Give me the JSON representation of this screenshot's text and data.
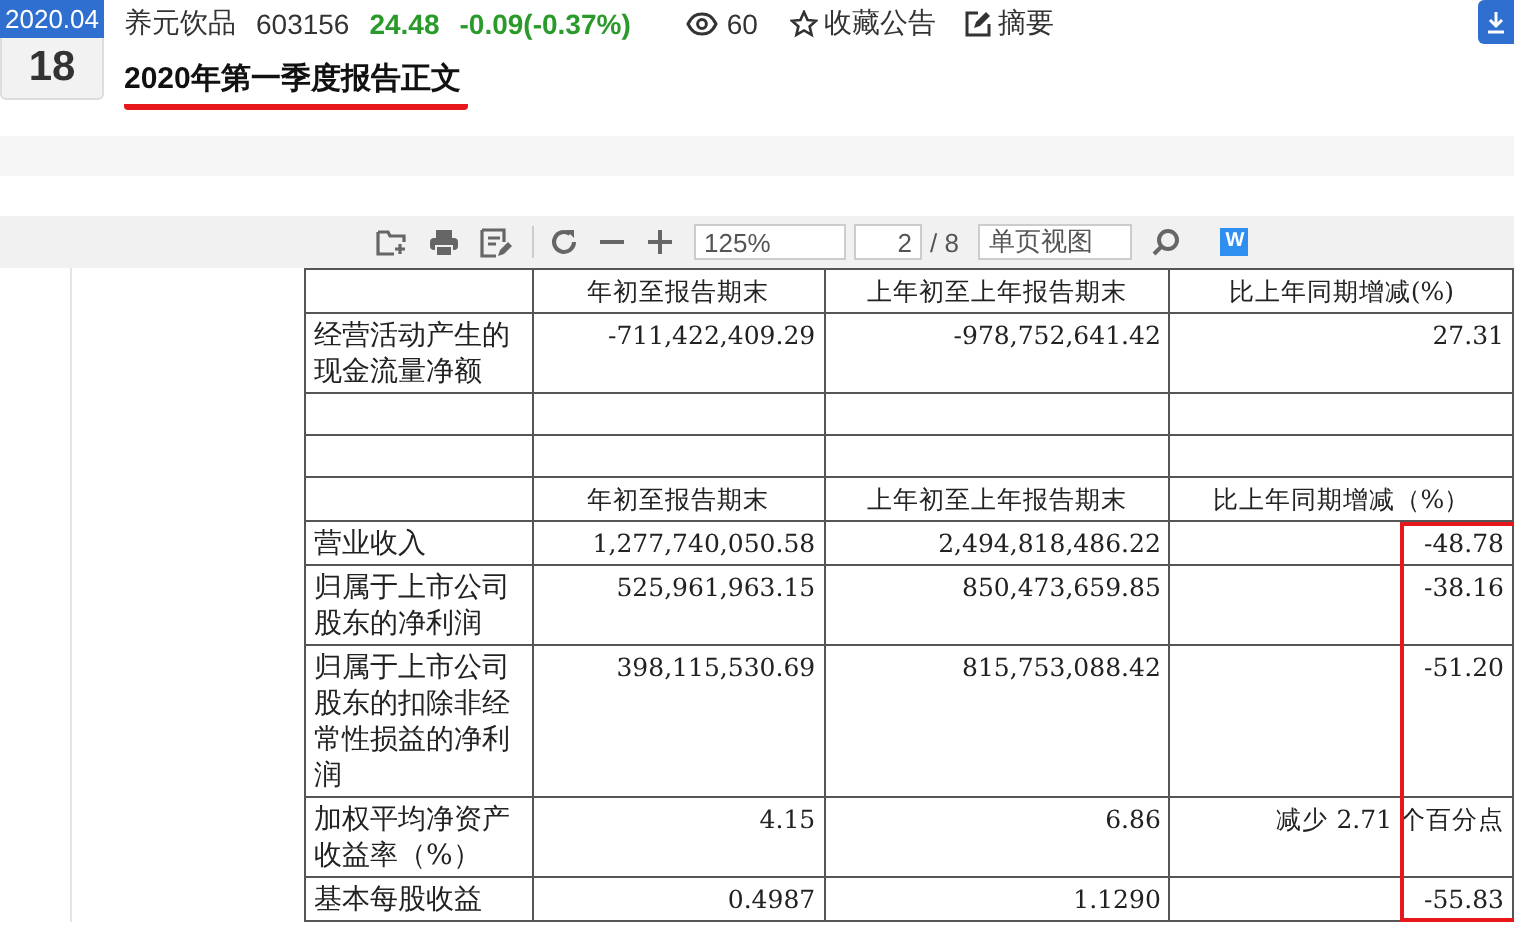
{
  "date_badge": {
    "month": "2020.04",
    "day": "18"
  },
  "stock": {
    "name": "养元饮品",
    "code": "603156",
    "price": "24.48",
    "change": "-0.09(-0.37%)"
  },
  "views": "60",
  "actions": [
    {
      "kind": "favorite",
      "label": "收藏公告"
    },
    {
      "kind": "summary",
      "label": "摘要"
    }
  ],
  "title": "2020年第一季度报告正文",
  "toolbar": {
    "zoom": "125%",
    "page": "2",
    "page_total": "/ 8",
    "view_mode": "单页视图",
    "word_label": "W"
  },
  "table": {
    "rows": [
      {
        "kind": "header",
        "cells": [
          "",
          "年初至报告期末",
          "上年初至上年报告期末",
          "比上年同期增减(%)"
        ]
      },
      {
        "kind": "data",
        "cells": [
          "经营活动产生的现金流量净额",
          "-711,422,409.29",
          "-978,752,641.42",
          "27.31"
        ],
        "highlighted": false
      },
      {
        "kind": "empty"
      },
      {
        "kind": "empty"
      },
      {
        "kind": "header",
        "cells": [
          "",
          "年初至报告期末",
          "上年初至上年报告期末",
          "比上年同期增减（%）"
        ]
      },
      {
        "kind": "data",
        "cells": [
          "营业收入",
          "1,277,740,050.58",
          "2,494,818,486.22",
          "-48.78"
        ],
        "highlighted": true
      },
      {
        "kind": "data",
        "cells": [
          "归属于上市公司股东的净利润",
          "525,961,963.15",
          "850,473,659.85",
          "-38.16"
        ],
        "highlighted": true
      },
      {
        "kind": "data",
        "cells": [
          "归属于上市公司股东的扣除非经常性损益的净利润",
          "398,115,530.69",
          "815,753,088.42",
          "-51.20"
        ],
        "highlighted": true
      },
      {
        "kind": "data",
        "cells": [
          "加权平均净资产收益率（%）",
          "4.15",
          "6.86",
          "减少 2.71 个百分点"
        ],
        "highlighted": true
      },
      {
        "kind": "data",
        "cells": [
          "基本每股收益",
          "0.4987",
          "1.1290",
          "-55.83"
        ],
        "highlighted": true
      }
    ]
  }
}
